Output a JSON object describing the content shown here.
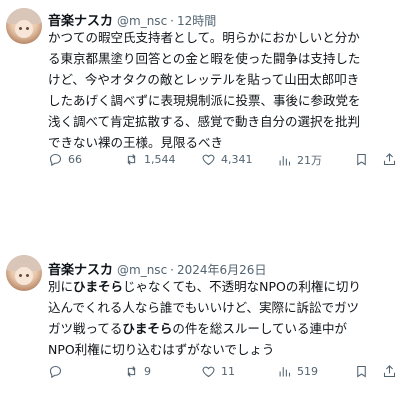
{
  "tweets": [
    {
      "name": "音楽ナスカ",
      "handle": "@m_nsc",
      "dot": "·",
      "time": "12時間",
      "lines": [
        "かつての暇空氏支持者として。明らかにおかしいと分か",
        "る東京都黒塗り回答との金と暇を使った闘争は支持した",
        "けど、今やオタクの敵とレッテルを貼って山田太郎叩き",
        "したあげく調べずに表現規制派に投票、事後に参政党を",
        "浅く調べて肯定拡散する、感覚で動き自分の選択を批判",
        "できない裸の王様。見限るべき"
      ],
      "replies": "66",
      "reposts": "1,544",
      "likes": "4,341",
      "views": "21万"
    },
    {
      "name": "音楽ナスカ",
      "handle": "@m_nsc",
      "dot": "·",
      "time": "2024年6月26日",
      "line1_a": "別に",
      "line1_bold": "ひまそら",
      "line1_b": "じゃなくても、不透明なNPOの利権に切り",
      "line2": "込んでくれる人なら誰でもいいけど、実際に訴訟でガツ",
      "line3_a": "ガツ戦ってる",
      "line3_bold": "ひまそら",
      "line3_b": "の件を総スルーしている連中が",
      "line4": "NPO利権に切り込むはずがないでしょう",
      "replies": "",
      "reposts": "9",
      "likes": "11",
      "views": "519"
    }
  ],
  "icons": {
    "reply": "reply-icon",
    "repost": "repost-icon",
    "like": "like-icon",
    "views": "views-icon",
    "bookmark": "bookmark-icon",
    "share": "share-icon"
  },
  "colors": {
    "text": "#0f1419",
    "secondary": "#536471"
  }
}
